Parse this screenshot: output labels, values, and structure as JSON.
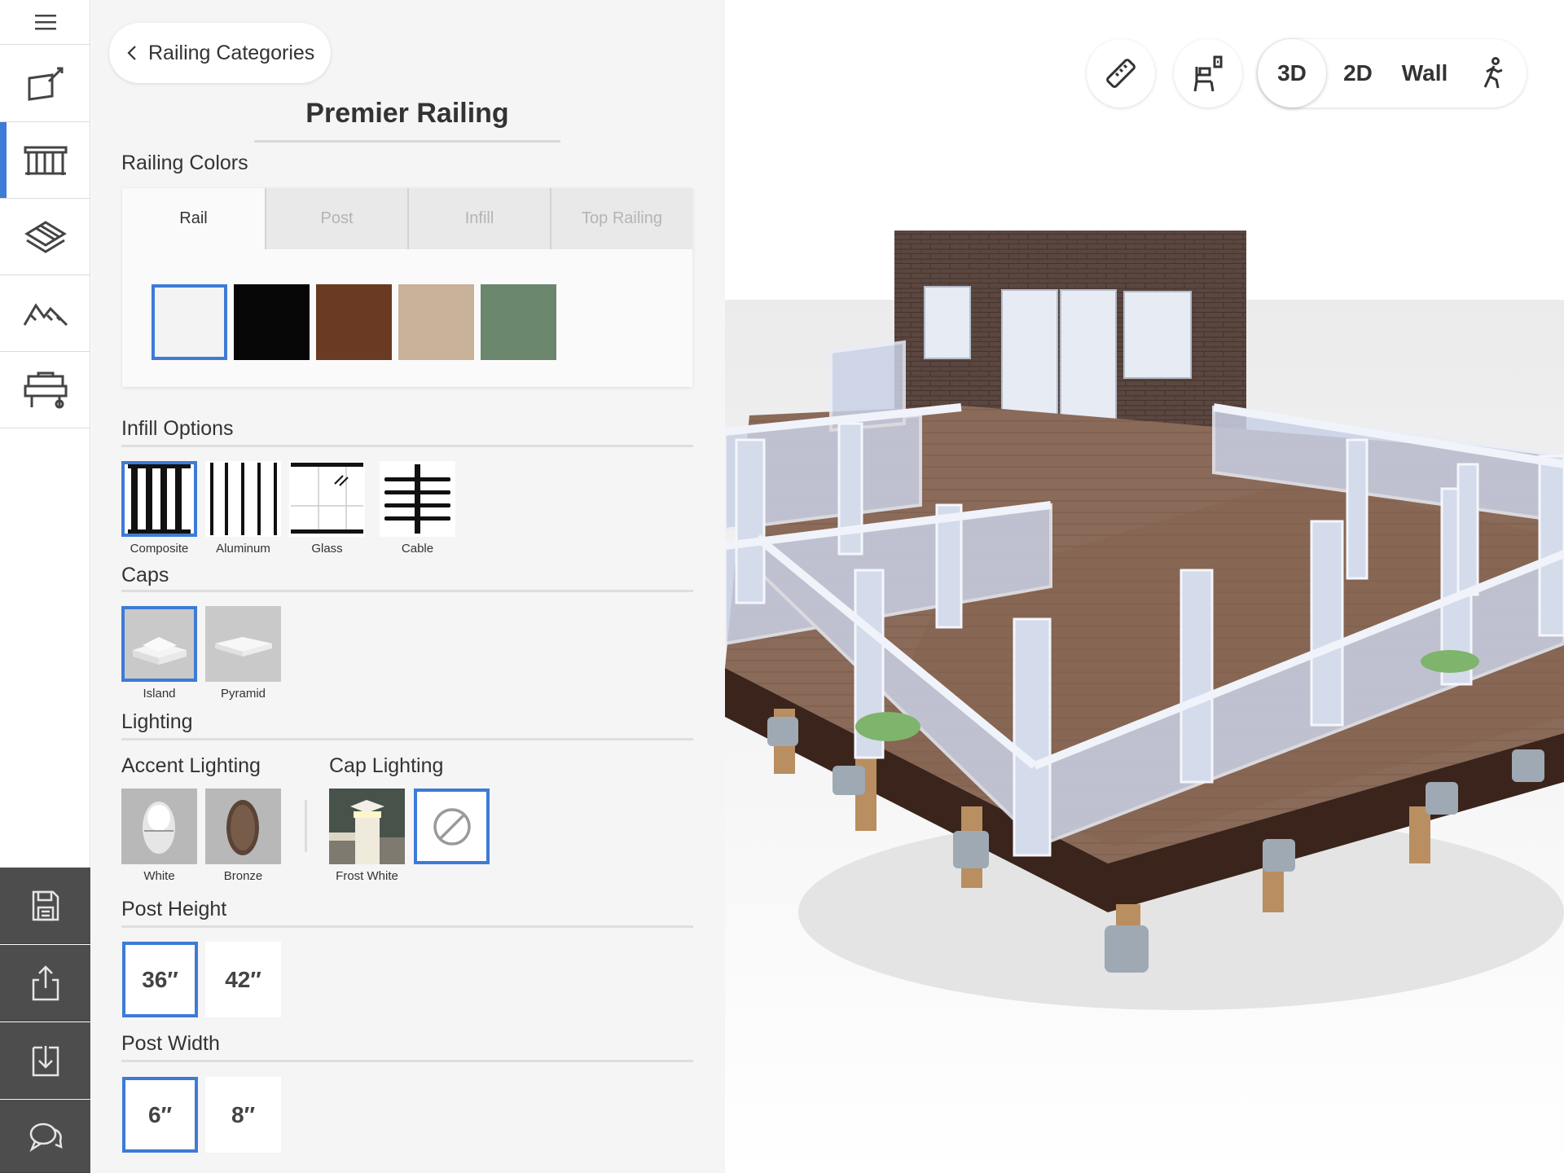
{
  "nav": {
    "items": [
      "menu-icon",
      "design-icon",
      "railing-icon",
      "decking-icon",
      "landscape-icon",
      "grill-icon"
    ],
    "active": "railing-icon",
    "bottom_items": [
      "save-icon",
      "share-icon",
      "download-icon",
      "chat-icon"
    ]
  },
  "panel": {
    "back_label": "Railing Categories",
    "title": "Premier Railing",
    "railing_colors": {
      "heading": "Railing Colors",
      "tabs": [
        "Rail",
        "Post",
        "Infill",
        "Top Railing"
      ],
      "active_tab": "Rail",
      "swatches": [
        "#f3f3f3",
        "#060606",
        "#6a3a22",
        "#c9b29a",
        "#6a876d"
      ],
      "selected_swatch": 0
    },
    "infill": {
      "heading": "Infill Options",
      "options": [
        "Composite",
        "Aluminum",
        "Glass",
        "Cable"
      ],
      "selected": "Composite"
    },
    "caps": {
      "heading": "Caps",
      "options": [
        "Island",
        "Pyramid"
      ],
      "selected": "Island"
    },
    "lighting": {
      "heading": "Lighting",
      "accent": {
        "heading": "Accent Lighting",
        "options": [
          "White",
          "Bronze"
        ]
      },
      "cap": {
        "heading": "Cap Lighting",
        "options": [
          "Frost White",
          ""
        ],
        "selected": "none"
      }
    },
    "post_height": {
      "heading": "Post Height",
      "options": [
        "36″",
        "42″"
      ],
      "selected": "36″"
    },
    "post_width": {
      "heading": "Post Width",
      "options": [
        "6″",
        "8″"
      ],
      "selected": "6″"
    }
  },
  "viewport": {
    "tools": [
      "ruler-icon",
      "furniture-icon"
    ],
    "views": [
      "3D",
      "2D",
      "Wall"
    ],
    "active_view": "3D",
    "walk_icon": "walk-icon"
  },
  "colors": {
    "accent": "#3d7bd6",
    "rail_dark": "#4d4d4d",
    "panel_bg": "#f5f5f5"
  }
}
